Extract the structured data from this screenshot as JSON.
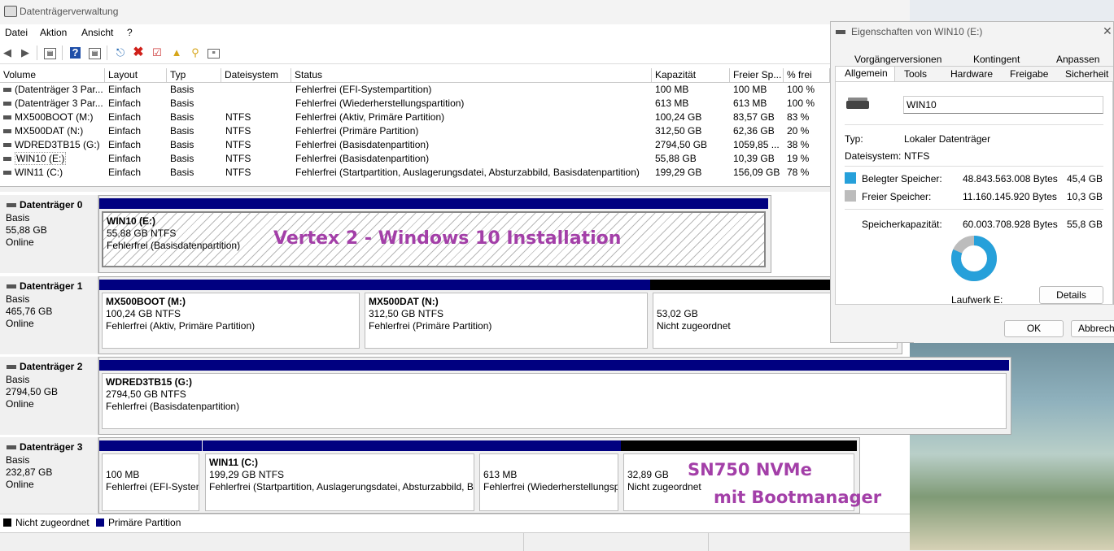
{
  "window": {
    "title": "Datenträgerverwaltung"
  },
  "menu": [
    "Datei",
    "Aktion",
    "Ansicht",
    "?"
  ],
  "toolbar_icons": [
    "back-icon",
    "forward-icon",
    "console-tree-icon",
    "help-icon",
    "properties-icon",
    "connect-icon",
    "delete-icon",
    "check-icon",
    "folder-up-icon",
    "search-folder-icon",
    "settings-icon"
  ],
  "columns": [
    "Volume",
    "Layout",
    "Typ",
    "Dateisystem",
    "Status",
    "Kapazität",
    "Freier Sp...",
    "% frei"
  ],
  "volumes": [
    [
      "(Datenträger 3 Par...",
      "Einfach",
      "Basis",
      "",
      "Fehlerfrei (EFI-Systempartition)",
      "100 MB",
      "100 MB",
      "100 %"
    ],
    [
      "(Datenträger 3 Par...",
      "Einfach",
      "Basis",
      "",
      "Fehlerfrei (Wiederherstellungspartition)",
      "613 MB",
      "613 MB",
      "100 %"
    ],
    [
      "MX500BOOT (M:)",
      "Einfach",
      "Basis",
      "NTFS",
      "Fehlerfrei (Aktiv, Primäre Partition)",
      "100,24 GB",
      "83,57 GB",
      "83 %"
    ],
    [
      "MX500DAT (N:)",
      "Einfach",
      "Basis",
      "NTFS",
      "Fehlerfrei (Primäre Partition)",
      "312,50 GB",
      "62,36 GB",
      "20 %"
    ],
    [
      "WDRED3TB15 (G:)",
      "Einfach",
      "Basis",
      "NTFS",
      "Fehlerfrei (Basisdatenpartition)",
      "2794,50 GB",
      "1059,85 ...",
      "38 %"
    ],
    [
      "WIN10 (E:)",
      "Einfach",
      "Basis",
      "NTFS",
      "Fehlerfrei (Basisdatenpartition)",
      "55,88 GB",
      "10,39 GB",
      "19 %"
    ],
    [
      "WIN11 (C:)",
      "Einfach",
      "Basis",
      "NTFS",
      "Fehlerfrei (Startpartition, Auslagerungsdatei, Absturzabbild, Basisdatenpartition)",
      "199,29 GB",
      "156,09 GB",
      "78 %"
    ]
  ],
  "disks": [
    {
      "name": "Datenträger 0",
      "type": "Basis",
      "size": "55,88 GB",
      "state": "Online",
      "partitions": [
        {
          "t1": "WIN10  (E:)",
          "t2": "55,88 GB NTFS",
          "t3": "Fehlerfrei (Basisdatenpartition)"
        }
      ]
    },
    {
      "name": "Datenträger 1",
      "type": "Basis",
      "size": "465,76 GB",
      "state": "Online",
      "partitions": [
        {
          "t1": "MX500BOOT  (M:)",
          "t2": "100,24 GB NTFS",
          "t3": "Fehlerfrei (Aktiv, Primäre Partition)"
        },
        {
          "t1": "MX500DAT  (N:)",
          "t2": "312,50 GB NTFS",
          "t3": "Fehlerfrei (Primäre Partition)"
        },
        {
          "t1": "",
          "t2": "53,02 GB",
          "t3": "Nicht zugeordnet"
        }
      ]
    },
    {
      "name": "Datenträger 2",
      "type": "Basis",
      "size": "2794,50 GB",
      "state": "Online",
      "partitions": [
        {
          "t1": "WDRED3TB15  (G:)",
          "t2": "2794,50 GB NTFS",
          "t3": "Fehlerfrei (Basisdatenpartition)"
        }
      ]
    },
    {
      "name": "Datenträger 3",
      "type": "Basis",
      "size": "232,87 GB",
      "state": "Online",
      "partitions": [
        {
          "t1": "",
          "t2": "100 MB",
          "t3": "Fehlerfrei (EFI-Systen"
        },
        {
          "t1": "WIN11  (C:)",
          "t2": "199,29 GB NTFS",
          "t3": "Fehlerfrei (Startpartition, Auslagerungsdatei, Absturzabbild, B"
        },
        {
          "t1": "",
          "t2": "613 MB",
          "t3": "Fehlerfrei (Wiederherstellungsp"
        },
        {
          "t1": "",
          "t2": "32,89 GB",
          "t3": "Nicht zugeordnet"
        }
      ]
    }
  ],
  "annotations": {
    "vertex": "Vertex 2 - Windows 10 Installation",
    "sn750_line1": "SN750 NVMe",
    "sn750_line2": "mit Bootmanager"
  },
  "legend": {
    "unallocated": "Nicht zugeordnet",
    "primary": "Primäre Partition"
  },
  "dialog": {
    "title": "Eigenschaften von WIN10 (E:)",
    "tabs_row1": [
      "Vorgängerversionen",
      "Kontingent",
      "Anpassen"
    ],
    "tabs_row2": [
      "Allgemein",
      "Tools",
      "Hardware",
      "Freigabe",
      "Sicherheit"
    ],
    "name_value": "WIN10",
    "type_label": "Typ:",
    "type_value": "Lokaler Datenträger",
    "fs_label": "Dateisystem:",
    "fs_value": "NTFS",
    "used_label": "Belegter Speicher:",
    "used_bytes": "48.843.563.008 Bytes",
    "used_gb": "45,4 GB",
    "free_label": "Freier Speicher:",
    "free_bytes": "11.160.145.920 Bytes",
    "free_gb": "10,3 GB",
    "cap_label": "Speicherkapazität:",
    "cap_bytes": "60.003.708.928 Bytes",
    "cap_gb": "55,8 GB",
    "drive_label": "Laufwerk E:",
    "details_button": "Details",
    "ok_button": "OK",
    "cancel_button": "Abbrechen",
    "used_fraction": 0.814,
    "used_color": "#26a0da",
    "free_color": "#bcbcbc"
  }
}
